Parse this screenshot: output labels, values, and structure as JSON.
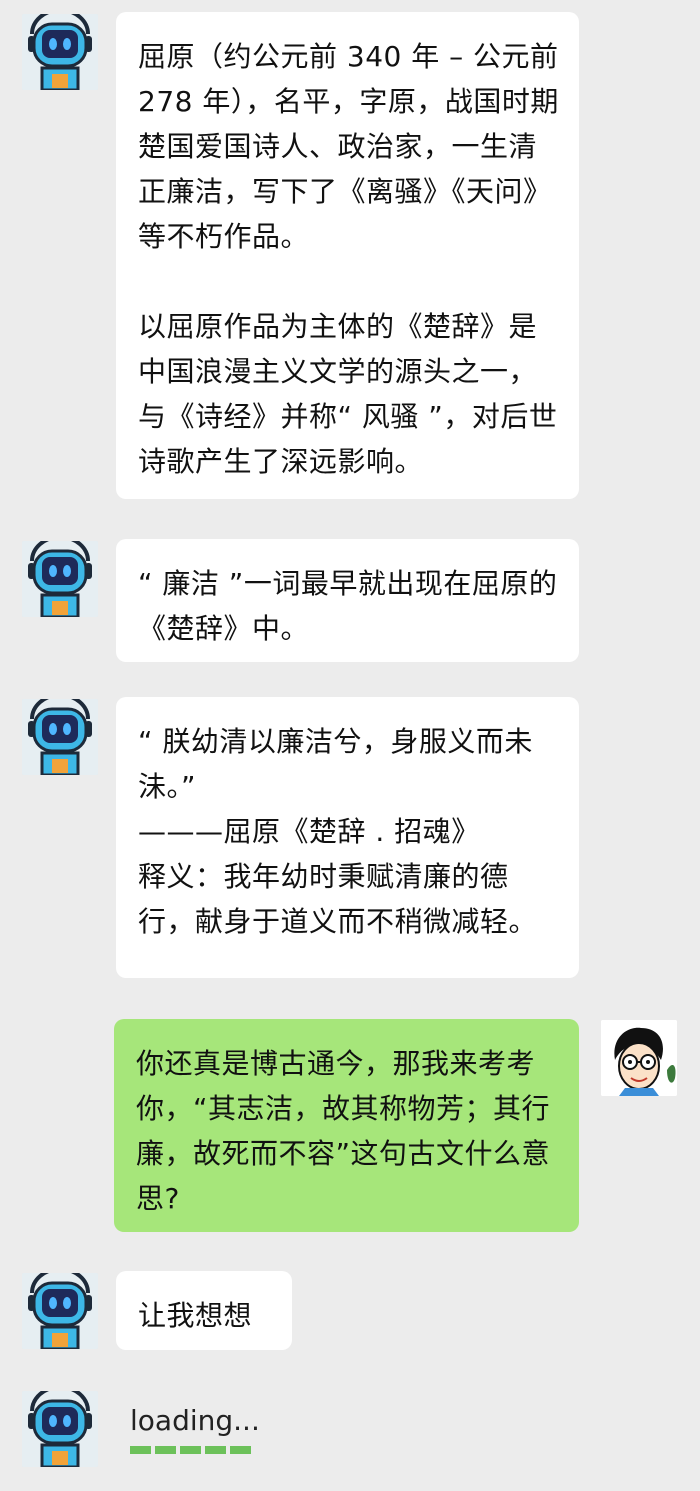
{
  "messages": [
    {
      "sender": "bot",
      "paragraphs": [
        "屈原（约公元前 340 年 – 公元前 278 年），名平，字原，战国时期楚国爱国诗人、政治家，一生清正廉洁，写下了《离骚》《天问》等不朽作品。",
        "以屈原作品为主体的《楚辞》是中国浪漫主义文学的源头之一，与《诗经》并称“ 风骚 ”，对后世诗歌产生了深远影响。"
      ]
    },
    {
      "sender": "bot",
      "paragraphs": [
        "“ 廉洁 ”一词最早就出现在屈原的《楚辞》中。"
      ]
    },
    {
      "sender": "bot",
      "lines": [
        "“ 朕幼清以廉洁兮，身服义而未沬。”",
        "———屈原《楚辞 . 招魂》",
        "释义：我年幼时秉赋清廉的德行，献身于道义而不稍微减轻。"
      ]
    },
    {
      "sender": "user",
      "paragraphs": [
        "你还真是博古通今，那我来考考你，“其志洁，故其称物芳；其行廉，故死而不容”这句古文什么意思?"
      ]
    },
    {
      "sender": "bot",
      "paragraphs": [
        "让我想想"
      ]
    }
  ],
  "loading": {
    "text": "loading...",
    "segments": 5,
    "color": "#6cc15a"
  },
  "colors": {
    "background": "#ececec",
    "bot_bubble": "#ffffff",
    "user_bubble": "#a6e67a"
  },
  "icons": {
    "bot_avatar": "robot-avatar-icon",
    "user_avatar": "user-avatar-icon"
  }
}
